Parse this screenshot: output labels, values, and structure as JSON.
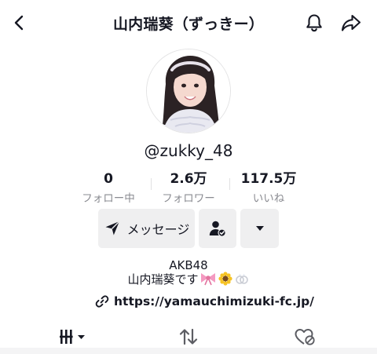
{
  "header": {
    "title": "山内瑞葵（ずっきー）",
    "back_icon": "chevron-left-icon",
    "bell_icon": "bell-icon",
    "share_icon": "share-arrow-icon"
  },
  "profile": {
    "username": "@zukky_48"
  },
  "stats": [
    {
      "value": "0",
      "label": "フォロー中"
    },
    {
      "value": "2.6万",
      "label": "フォロワー"
    },
    {
      "value": "117.5万",
      "label": "いいね"
    }
  ],
  "actions": {
    "message_label": "メッセージ",
    "message_icon": "paper-plane-icon",
    "friend_icon": "person-check-icon",
    "more_icon": "caret-down-icon"
  },
  "bio": {
    "line1": "AKB48",
    "line2": "山内瑞葵です"
  },
  "link": {
    "url": "https://yamauchimizuki-fc.jp/",
    "icon": "link-icon"
  },
  "tabs": [
    {
      "name": "videos",
      "icon": "grid-bars-icon",
      "active": true
    },
    {
      "name": "reposts",
      "icon": "repost-arrows-icon",
      "active": false
    },
    {
      "name": "liked",
      "icon": "heart-lock-icon",
      "active": false
    }
  ],
  "colors": {
    "text": "#161823",
    "secondary_text": "#8a8b91",
    "button_bg": "#efeff0"
  }
}
